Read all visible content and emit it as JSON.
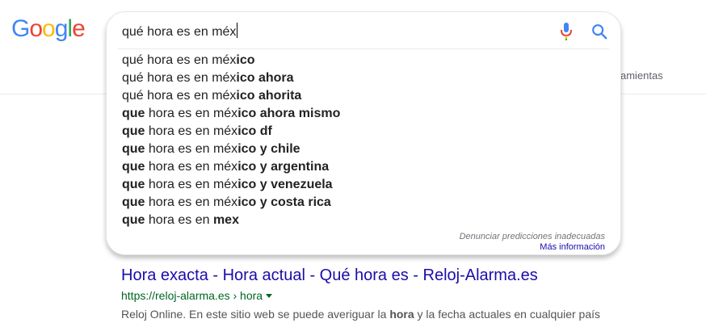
{
  "logo": {
    "letters": [
      {
        "char": "G",
        "color": "#4285f4"
      },
      {
        "char": "o",
        "color": "#ea4335"
      },
      {
        "char": "o",
        "color": "#fbbc05"
      },
      {
        "char": "g",
        "color": "#4285f4"
      },
      {
        "char": "l",
        "color": "#34a853"
      },
      {
        "char": "e",
        "color": "#ea4335"
      }
    ]
  },
  "search": {
    "query": "qué hora es en méx",
    "mic_icon": "microphone-icon",
    "search_icon": "magnifier-icon",
    "suggestions": [
      [
        {
          "t": "qué hora es en méx",
          "b": false
        },
        {
          "t": "ico",
          "b": true
        }
      ],
      [
        {
          "t": "qué hora es en méx",
          "b": false
        },
        {
          "t": "ico ahora",
          "b": true
        }
      ],
      [
        {
          "t": "qué hora es en méx",
          "b": false
        },
        {
          "t": "ico ahorita",
          "b": true
        }
      ],
      [
        {
          "t": "que",
          "b": true
        },
        {
          "t": " hora es en méx",
          "b": false
        },
        {
          "t": "ico ahora mismo",
          "b": true
        }
      ],
      [
        {
          "t": "que",
          "b": true
        },
        {
          "t": " hora es en méx",
          "b": false
        },
        {
          "t": "ico df",
          "b": true
        }
      ],
      [
        {
          "t": "que",
          "b": true
        },
        {
          "t": " hora es en méx",
          "b": false
        },
        {
          "t": "ico y chile",
          "b": true
        }
      ],
      [
        {
          "t": "que",
          "b": true
        },
        {
          "t": " hora es en méx",
          "b": false
        },
        {
          "t": "ico y argentina",
          "b": true
        }
      ],
      [
        {
          "t": "que",
          "b": true
        },
        {
          "t": " hora es en méx",
          "b": false
        },
        {
          "t": "ico y venezuela",
          "b": true
        }
      ],
      [
        {
          "t": "que",
          "b": true
        },
        {
          "t": " hora es en méx",
          "b": false
        },
        {
          "t": "ico y costa rica",
          "b": true
        }
      ],
      [
        {
          "t": "que",
          "b": true
        },
        {
          "t": " hora es en ",
          "b": false
        },
        {
          "t": "mex",
          "b": true
        }
      ]
    ],
    "report_link": "Denunciar predicciones inadecuadas",
    "more_info_link": "Más información"
  },
  "toolbar": {
    "tools_partial": "amientas"
  },
  "result": {
    "title": "Hora exacta - Hora actual - Qué hora es - Reloj-Alarma.es",
    "url": "https://reloj-alarma.es › hora",
    "snippet": [
      {
        "t": "Reloj Online. En este sitio web se puede averiguar la ",
        "b": false
      },
      {
        "t": "hora",
        "b": true
      },
      {
        "t": " y la fecha actuales en cualquier país",
        "b": false
      }
    ]
  },
  "colors": {
    "link_blue": "#1a0dab",
    "url_green": "#006621",
    "mic_blue": "#4285f4",
    "mic_red": "#ea4335",
    "mic_yellow": "#fbbc05",
    "mic_green": "#34a853"
  }
}
